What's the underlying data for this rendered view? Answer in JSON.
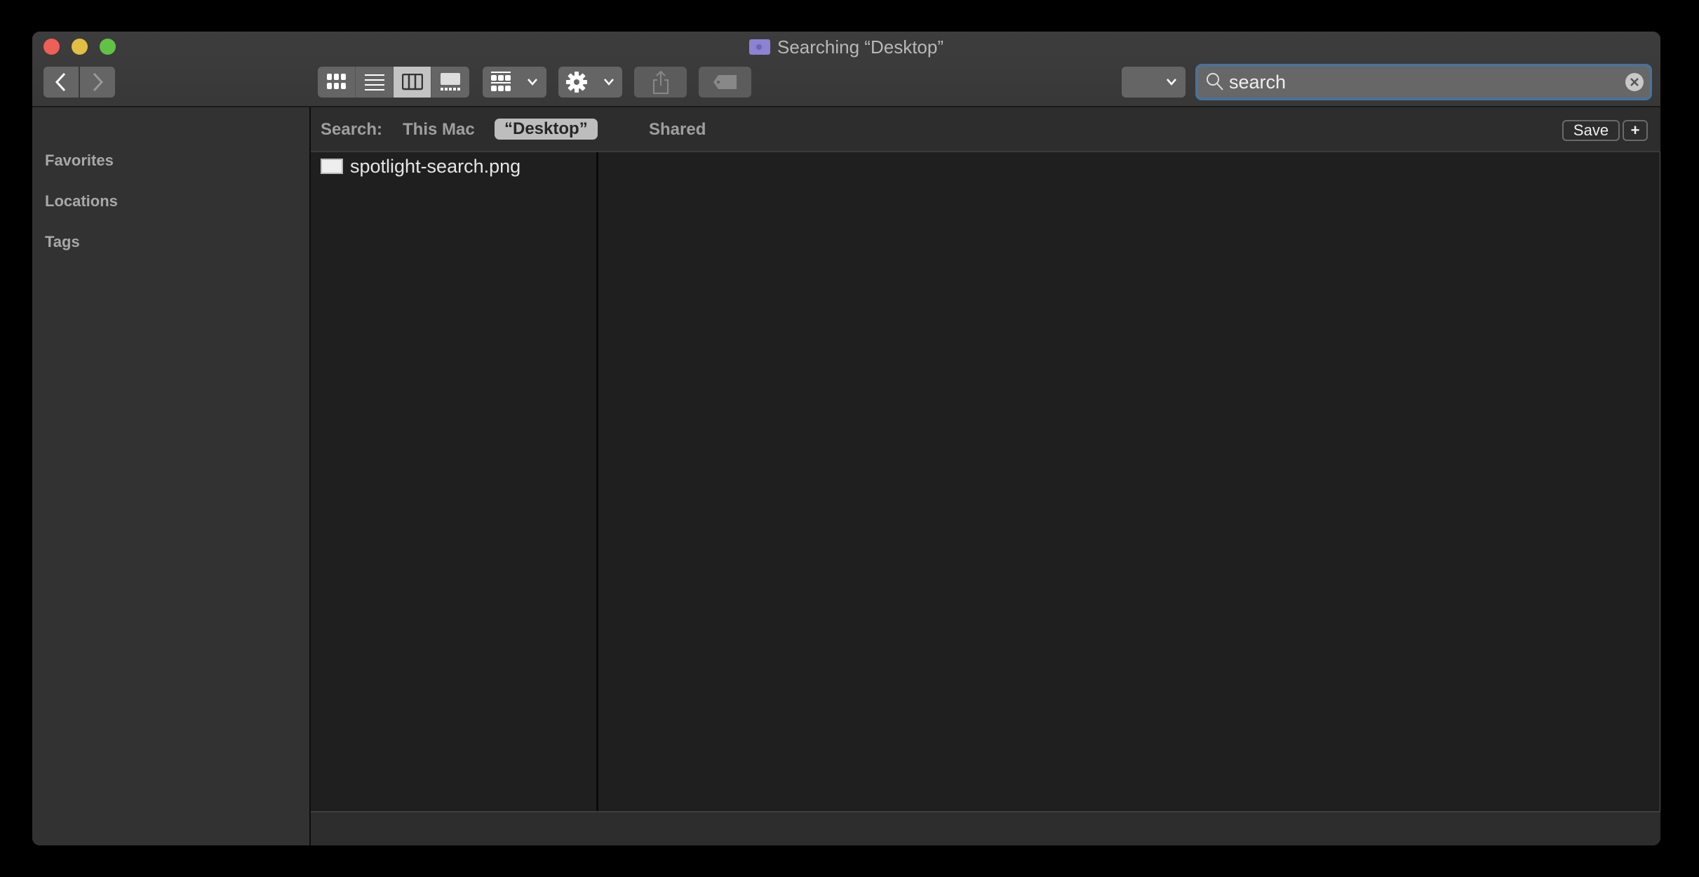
{
  "window": {
    "title": "Searching “Desktop”",
    "traffic_lights": {
      "close": "#ee5f57",
      "minimize": "#e0bf44",
      "zoom": "#62c246"
    }
  },
  "toolbar": {
    "back_icon": "chevron-left-icon",
    "forward_icon": "chevron-right-icon",
    "views": [
      {
        "name": "icon-view",
        "icon": "grid-icon",
        "active": false
      },
      {
        "name": "list-view",
        "icon": "list-icon",
        "active": false
      },
      {
        "name": "column-view",
        "icon": "columns-icon",
        "active": true
      },
      {
        "name": "gallery-view",
        "icon": "gallery-icon",
        "active": false
      }
    ],
    "group_icon": "group-icon",
    "action_icon": "gear-icon",
    "share_icon": "share-icon",
    "tag_icon": "tag-icon",
    "search": {
      "value": "search",
      "accent": "#4a729a"
    }
  },
  "sidebar": {
    "sections": [
      "Favorites",
      "Locations",
      "Tags"
    ]
  },
  "scope_bar": {
    "label": "Search:",
    "scopes": [
      "This Mac",
      "“Desktop”",
      "Shared"
    ],
    "active_scope": "“Desktop”",
    "save_label": "Save",
    "add_label": "+"
  },
  "results": [
    {
      "name": "spotlight-search.png",
      "icon": "image-file-icon"
    }
  ]
}
